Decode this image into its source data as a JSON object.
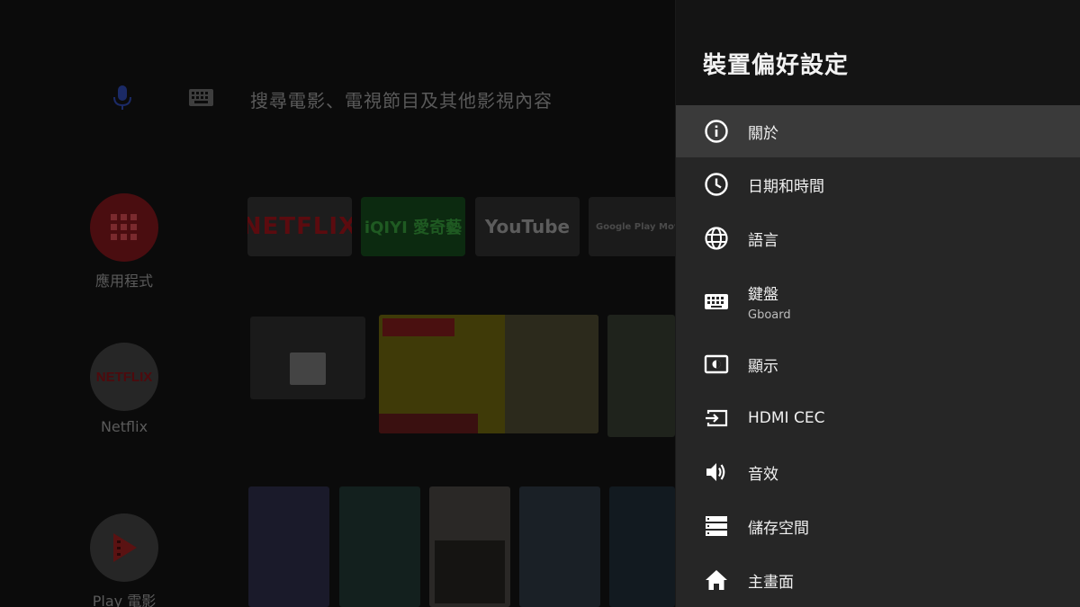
{
  "home": {
    "search_placeholder": "搜尋電影、電視節目及其他影視內容",
    "sidebar_apps": [
      {
        "label": "應用程式",
        "icon": "apps-grid-icon"
      },
      {
        "label": "Netflix",
        "icon": "netflix-logo"
      },
      {
        "label": "Play 電影",
        "icon": "play-movies-logo"
      }
    ],
    "app_tiles": [
      {
        "label": "NETFLIX"
      },
      {
        "label": "iQIYI 愛奇藝"
      },
      {
        "label": "YouTube"
      },
      {
        "label": "Google Play Movies"
      }
    ]
  },
  "settings": {
    "title": "裝置偏好設定",
    "items": [
      {
        "label": "關於",
        "icon": "info-icon"
      },
      {
        "label": "日期和時間",
        "icon": "clock-icon"
      },
      {
        "label": "語言",
        "icon": "globe-icon"
      },
      {
        "label": "鍵盤",
        "sublabel": "Gboard",
        "icon": "keyboard-icon"
      },
      {
        "label": "顯示",
        "icon": "display-icon"
      },
      {
        "label": "HDMI CEC",
        "icon": "hdmi-input-icon"
      },
      {
        "label": "音效",
        "icon": "volume-icon"
      },
      {
        "label": "儲存空間",
        "icon": "storage-icon"
      },
      {
        "label": "主畫面",
        "icon": "home-icon"
      }
    ]
  },
  "colors": {
    "panel_bg": "#262626",
    "panel_header_bg": "#141414",
    "selected_bg": "#3a3a3a"
  }
}
